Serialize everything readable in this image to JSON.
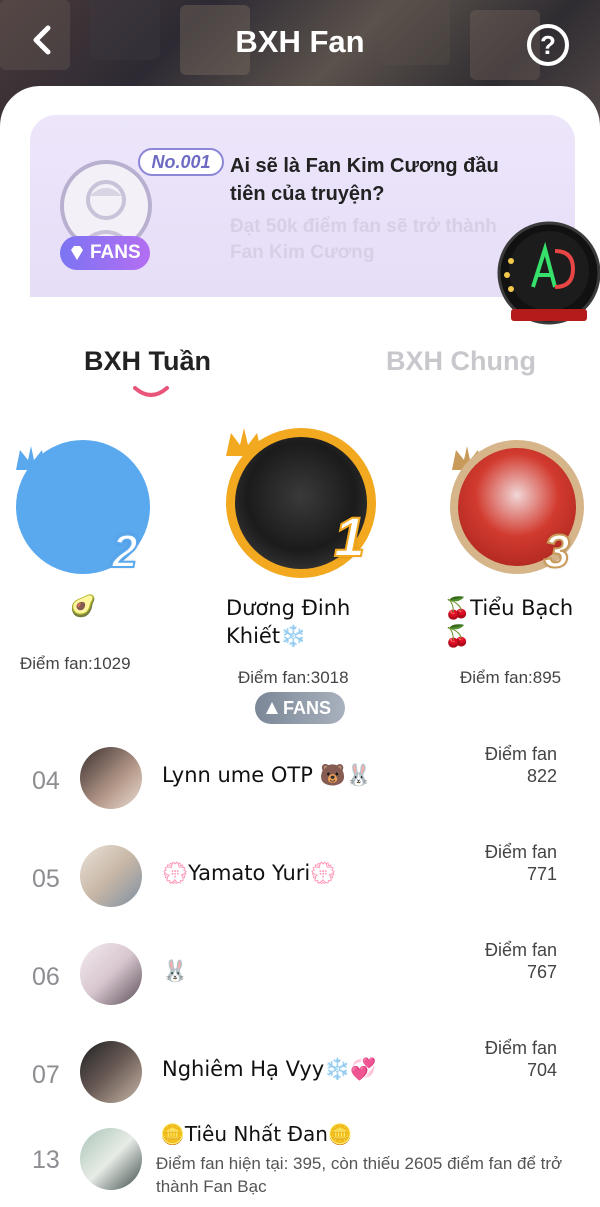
{
  "header": {
    "title": "BXH Fan"
  },
  "banner": {
    "badge_no": "No.001",
    "fan_badge": "FANS",
    "title": "Ai sẽ là Fan Kim Cương đầu tiên của truyện?",
    "subtitle": "Đạt 50k điểm fan sẽ trở thành Fan Kim Cương"
  },
  "tabs": [
    {
      "label": "BXH Tuần",
      "active": true
    },
    {
      "label": "BXH Chung",
      "active": false
    }
  ],
  "podium": [
    {
      "rank": "1",
      "name": "Dương Đinh Khiết❄️",
      "score": "Điểm fan:3018"
    },
    {
      "rank": "2",
      "name": "🥑",
      "score": "Điểm fan:1029"
    },
    {
      "rank": "3",
      "name": "🍒Tiểu Bạch 🍒",
      "score": "Điểm fan:895"
    }
  ],
  "fans_pill": "FANS",
  "list": [
    {
      "rank": "04",
      "name": "Lynn ume OTP 🐻🐰",
      "score_label": "Điểm fan",
      "score": "822"
    },
    {
      "rank": "05",
      "name": "💮Yamato Yuri💮",
      "score_label": "Điểm fan",
      "score": "771"
    },
    {
      "rank": "06",
      "name": "🐰",
      "score_label": "Điểm fan",
      "score": "767"
    },
    {
      "rank": "07",
      "name": "Nghiêm Hạ Vyy❄️💞",
      "score_label": "Điểm fan",
      "score": "704"
    }
  ],
  "me": {
    "rank": "13",
    "name": "🪙Tiêu Nhất Đan🪙",
    "desc": "Điểm fan hiện tại: 395, còn thiếu 2605 điểm fan để trở thành Fan Bạc"
  },
  "colors": {
    "accent_pink": "#e8547a",
    "gold": "#f2a81f",
    "silver_blue": "#5aa8ee",
    "bronze": "#d23a2e"
  }
}
